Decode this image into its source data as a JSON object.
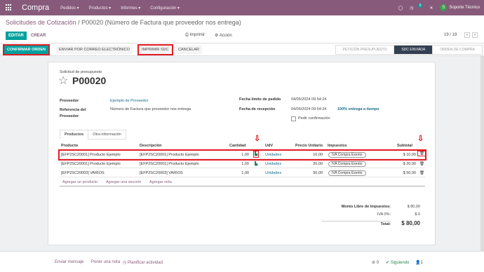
{
  "topbar": {
    "app": "Compra",
    "menus": [
      "Pedidos ▾",
      "Productos ▾",
      "Informes ▾",
      "Configuración ▾"
    ],
    "badge": "5",
    "user": "Soporte Técnico",
    "avatar": "S"
  },
  "breadcrumb": {
    "parent": "Solicitudes de Cotización",
    "current": " / P00020 (Número de Factura que proveedor nos entrega)"
  },
  "actions": {
    "edit": "EDITAR",
    "create": "CREAR",
    "print": "Imprimir",
    "action": "Acción",
    "pager": "19 / 19"
  },
  "status": {
    "confirm": "CONFIRMAR ORDEN",
    "send": "ENVIAR POR CORREO ELECTRÓNICO",
    "print": "IMPRIMIR SDC",
    "cancel": "CANCELAR",
    "stages": [
      "PETICIÓN PRESUPUESTO",
      "SDC ENVIADA",
      "ORDEN DE COMPRA"
    ],
    "active_stage": 1
  },
  "form": {
    "subtitle": "Solicitud de presupuesto",
    "name": "P00020",
    "star": "☆",
    "vendor_label": "Proveedor",
    "vendor": "Ejemplo de Proveedor",
    "ref_label": "Referencia del Proveedor",
    "ref": "Número de Factura que proveedor nos entrega",
    "deadline_label": "Fecha límite de pedido",
    "deadline": "04/05/2024 09:54:24",
    "receipt_label": "Fecha de recepción",
    "receipt": "04/05/2024 09:54:24",
    "ontime": "100% entrega a tiempo",
    "askconf": "Pedir confirmación"
  },
  "tabs": [
    "Productos",
    "Otra información"
  ],
  "table": {
    "headers": [
      "Producto",
      "Descripción",
      "Cantidad",
      "UdV",
      "Precio Unitario",
      "Impuestos",
      "Subtotal"
    ],
    "rows": [
      {
        "product": "[EFP2SC20001] Producto Ejemplo",
        "desc": "[EFP2SC20001] Producto Ejemplo",
        "qty": "1,00",
        "uom": "Unidades",
        "price": "10,00",
        "tax": "IVA Compra Exento",
        "subtotal": "$ 10,00"
      },
      {
        "product": "[EFP2SC20001] Producto Ejemplo",
        "desc": "[EFP2SC20001] Producto Ejemplo",
        "qty": "1,00",
        "uom": "Unidades",
        "price": "20,00",
        "tax": "IVA Compra Exento",
        "subtotal": "$ 20,00"
      },
      {
        "product": "[EFP2SC20003] VARIOS",
        "desc": "[EFP2SC20003] VARIOS",
        "qty": "1,00",
        "uom": "Unidades",
        "price": "50,00",
        "tax": "IVA Compra Exento",
        "subtotal": "$ 50,00"
      }
    ],
    "add": [
      "Agregar un producto",
      "Agregar una sección",
      "Agregar nota"
    ]
  },
  "totals": {
    "untaxed_label": "Monto Libre de Impuestos:",
    "untaxed": "$ 80,00",
    "iva_label": "IVA 0%:",
    "iva": "$ 0",
    "total_label": "Total:",
    "total": "$ 80,00"
  },
  "chatter": {
    "send": "Enviar mensaje",
    "note": "Poner una nota",
    "plan": "Planificar actividad",
    "followers": "0",
    "following": "Siguiendo",
    "count": "1"
  },
  "colors": {
    "brand": "#875a7b",
    "teal": "#00a09d",
    "highlight": "#e31b23"
  }
}
